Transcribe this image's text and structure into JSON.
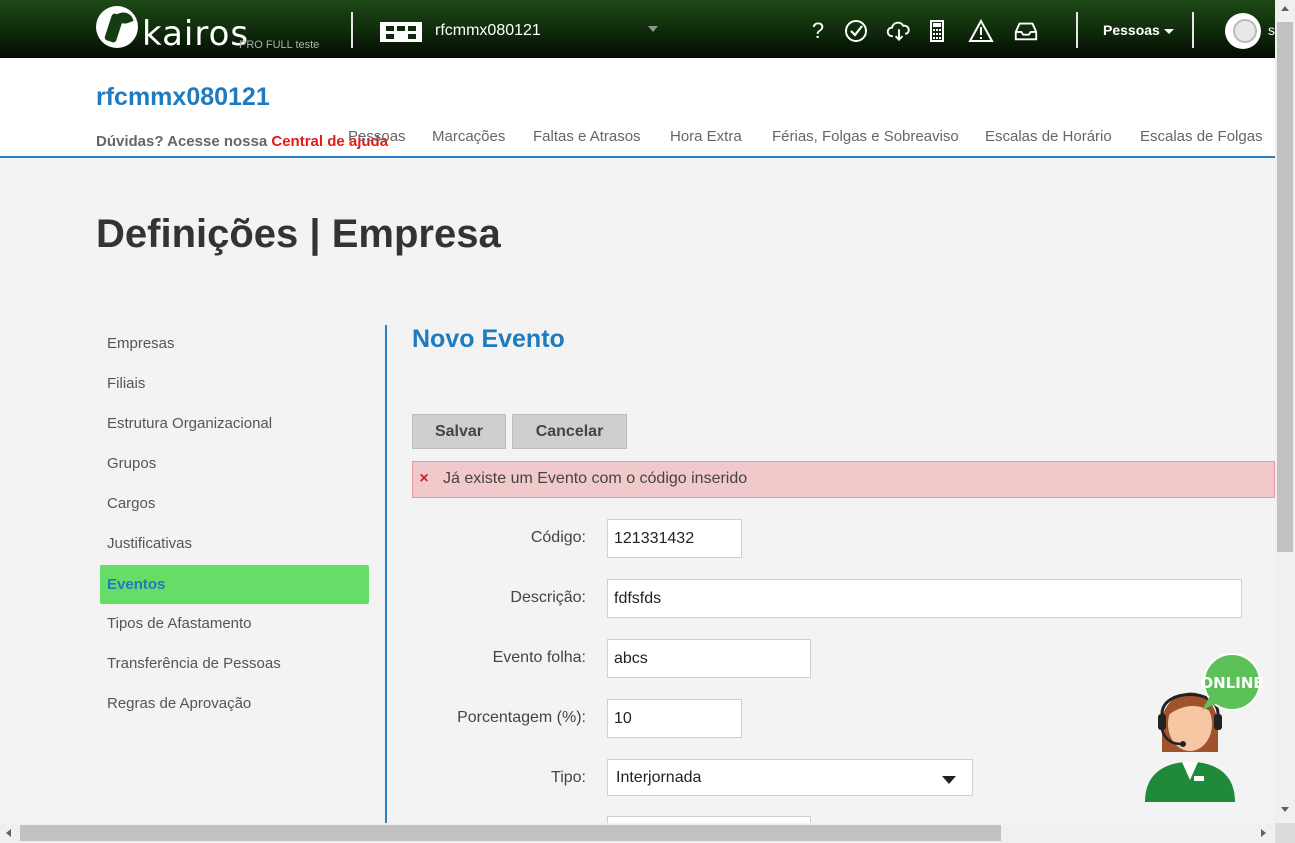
{
  "topbar": {
    "logo_text": "kairos",
    "logo_sub": "PRO FULL teste",
    "company_name": "rfcmmx080121",
    "icons": [
      "help-icon",
      "feedback-icon",
      "cloud-download-icon",
      "calculator-icon",
      "alert-icon",
      "inbox-icon"
    ],
    "help_glyph": "?",
    "user_menu_label": "Pessoas",
    "user_initial": "s"
  },
  "header": {
    "title": "rfcmmx080121",
    "help_prefix": "Dúvidas? Acesse nossa ",
    "help_link": "Central de ajuda",
    "nav": [
      "Pessoas",
      "Marcações",
      "Faltas e Atrasos",
      "Hora Extra",
      "Férias, Folgas e Sobreaviso",
      "Escalas de Horário",
      "Escalas de Folgas"
    ]
  },
  "page_title": "Definições | Empresa",
  "sidebar": {
    "items": [
      {
        "label": "Empresas",
        "active": false
      },
      {
        "label": "Filiais",
        "active": false
      },
      {
        "label": "Estrutura Organizacional",
        "active": false
      },
      {
        "label": "Grupos",
        "active": false
      },
      {
        "label": "Cargos",
        "active": false
      },
      {
        "label": "Justificativas",
        "active": false
      },
      {
        "label": "Eventos",
        "active": true
      },
      {
        "label": "Tipos de Afastamento",
        "active": false
      },
      {
        "label": "Transferência de Pessoas",
        "active": false
      },
      {
        "label": "Regras de Aprovação",
        "active": false
      }
    ]
  },
  "form": {
    "title": "Novo Evento",
    "save_label": "Salvar",
    "cancel_label": "Cancelar",
    "alert_text": "Já existe um Evento com o código inserido",
    "alert_icon": "×",
    "fields": {
      "codigo": {
        "label": "Código:",
        "value": "121331432"
      },
      "descricao": {
        "label": "Descrição:",
        "value": "fdfsfds"
      },
      "evento_folha": {
        "label": "Evento folha:",
        "value": "abcs"
      },
      "porcentagem": {
        "label": "Porcentagem (%):",
        "value": "10"
      },
      "tipo": {
        "label": "Tipo:",
        "value": "Interjornada"
      }
    }
  },
  "support_widget": {
    "badge": "ONLINE"
  },
  "colors": {
    "brand_green": "#0f2a0b",
    "accent_blue": "#1f7bc0",
    "active_green": "#66dd66",
    "alert_bg": "#f2c9cb",
    "link_red": "#e21a1a"
  }
}
